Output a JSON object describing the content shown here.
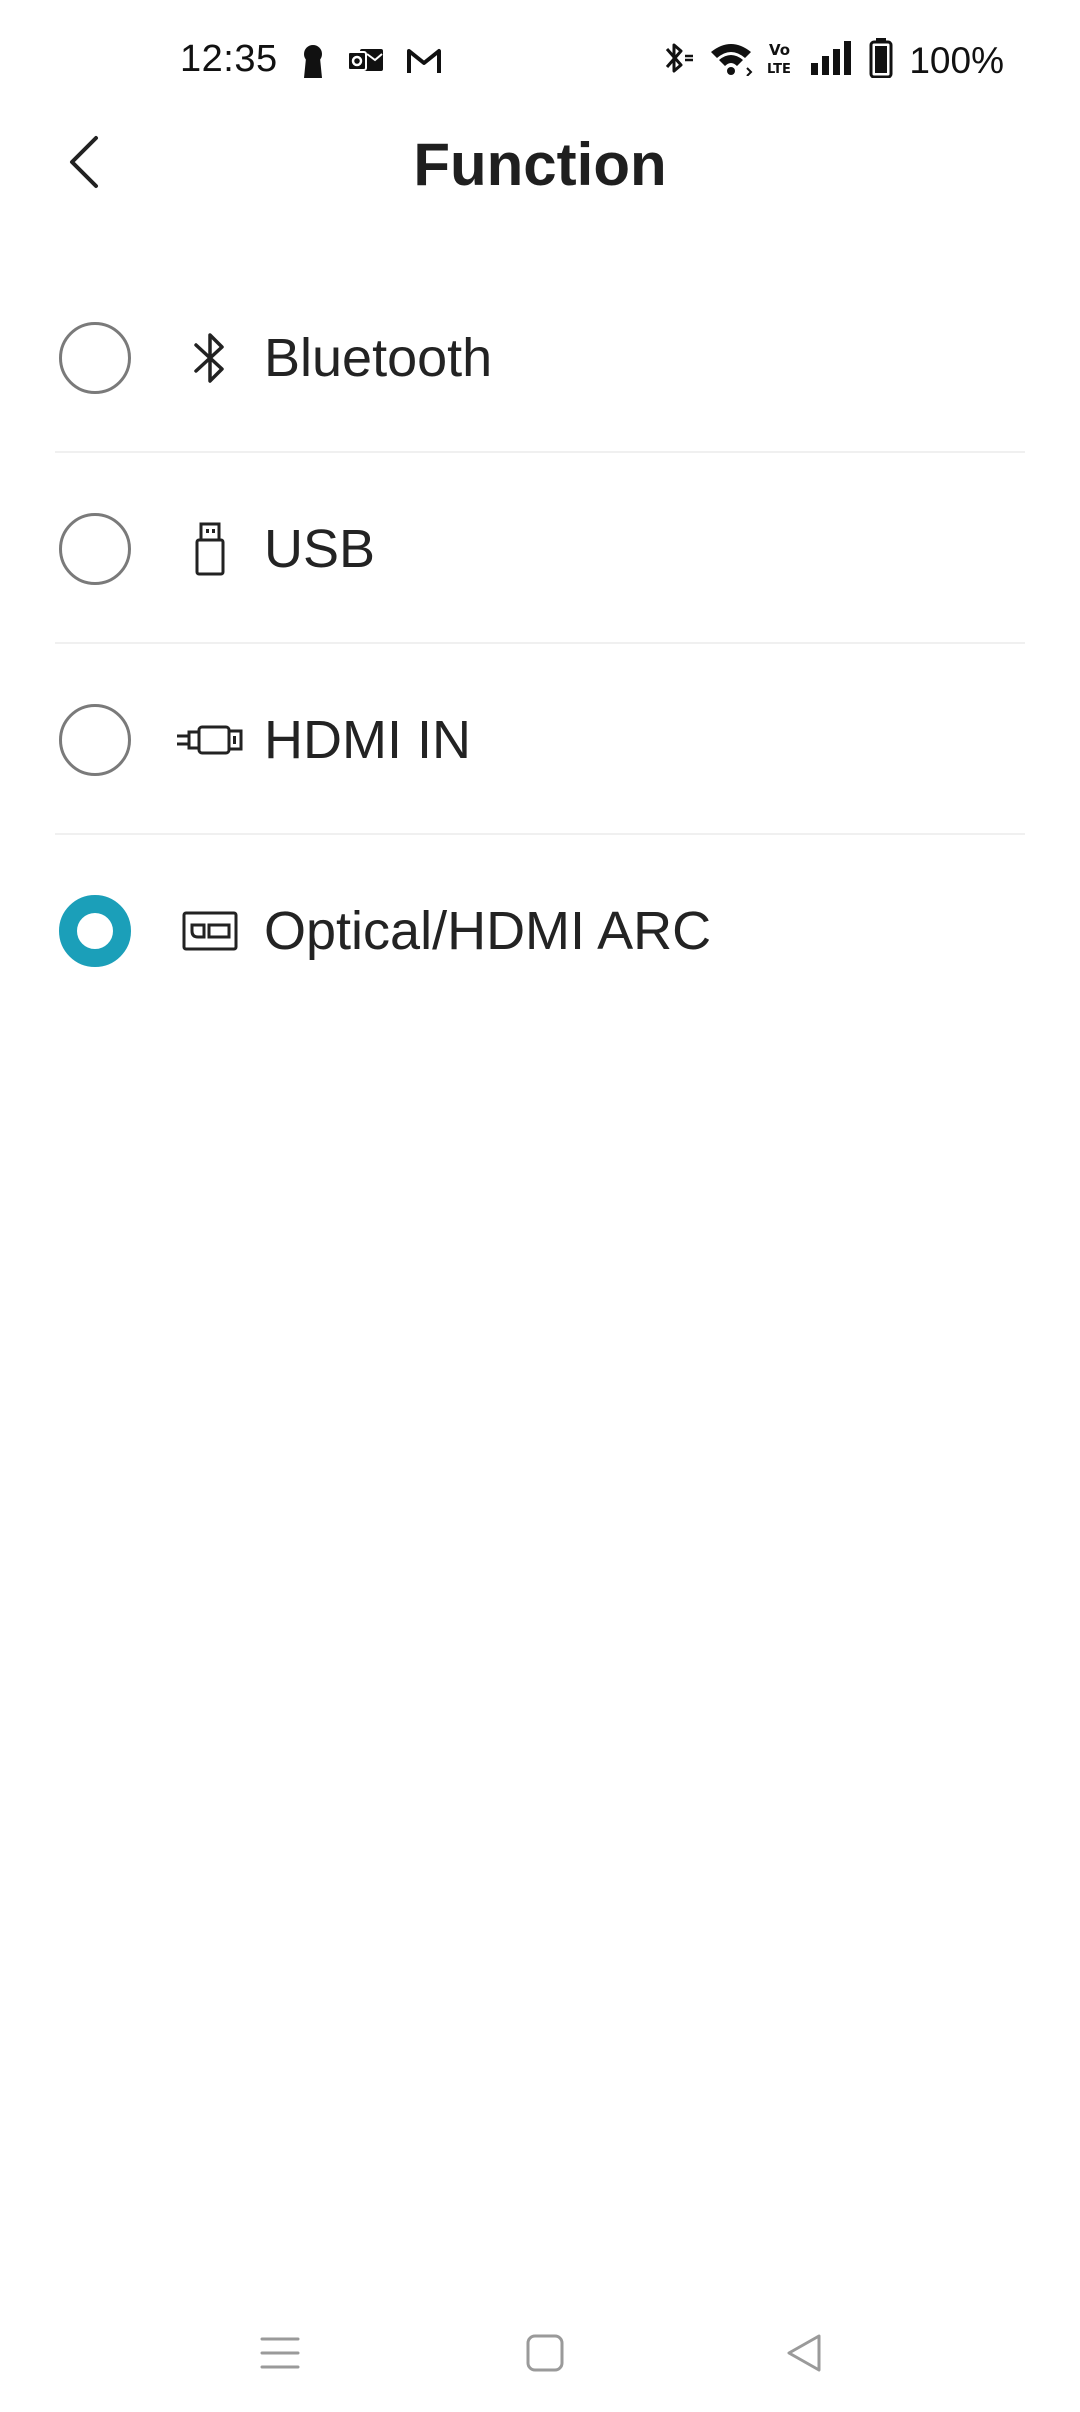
{
  "status_bar": {
    "time": "12:35",
    "left_icons": [
      "keyhole-icon",
      "outlook-icon",
      "gmail-icon"
    ],
    "right_icons": [
      "bluetooth-icon",
      "wifi-icon",
      "volte-icon",
      "signal-icon",
      "battery-icon"
    ],
    "volte_text_top": "Vo",
    "volte_text_bottom": "LTE",
    "battery": "100%"
  },
  "header": {
    "title": "Function",
    "back_icon": "chevron-left-icon"
  },
  "options": [
    {
      "label": "Bluetooth",
      "icon": "bluetooth-icon",
      "selected": false
    },
    {
      "label": "USB",
      "icon": "usb-drive-icon",
      "selected": false
    },
    {
      "label": "HDMI IN",
      "icon": "hdmi-cable-icon",
      "selected": false
    },
    {
      "label": "Optical/HDMI ARC",
      "icon": "hdmi-arc-port-icon",
      "selected": true
    }
  ],
  "colors": {
    "accent": "#1b9fb9",
    "text": "#232323",
    "divider": "#f0f0f0"
  },
  "nav_bar": {
    "icons": [
      "menu-icon",
      "home-square-icon",
      "back-triangle-icon"
    ]
  }
}
